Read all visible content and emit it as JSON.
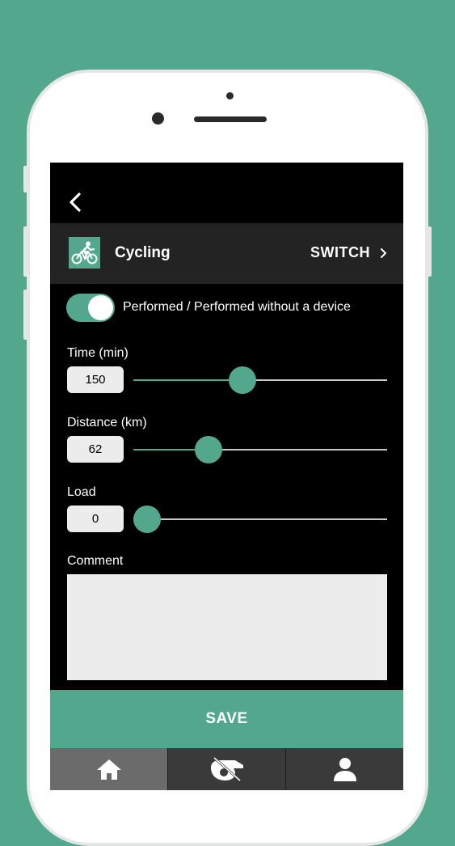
{
  "colors": {
    "accent": "#52a78d",
    "screen_bg": "#000000",
    "bar_bg": "#232323",
    "field_bg": "#ececec"
  },
  "header": {
    "back_icon": "chevron-left-icon"
  },
  "activity": {
    "icon": "cyclist-icon",
    "name": "Cycling",
    "switch_label": "SWITCH",
    "switch_icon": "chevron-right-icon"
  },
  "toggle": {
    "on": true,
    "label": "Performed / Performed without a device"
  },
  "fields": [
    {
      "label": "Time (min)",
      "value": "150",
      "slider_fraction": 0.42
    },
    {
      "label": "Distance (km)",
      "value": "62",
      "slider_fraction": 0.27
    },
    {
      "label": "Load",
      "value": "0",
      "slider_fraction": 0.0
    }
  ],
  "comment": {
    "label": "Comment",
    "value": ""
  },
  "save_label": "SAVE",
  "tabs": [
    {
      "icon": "home-icon",
      "active": true
    },
    {
      "icon": "whistle-icon",
      "active": false
    },
    {
      "icon": "user-icon",
      "active": false
    }
  ]
}
